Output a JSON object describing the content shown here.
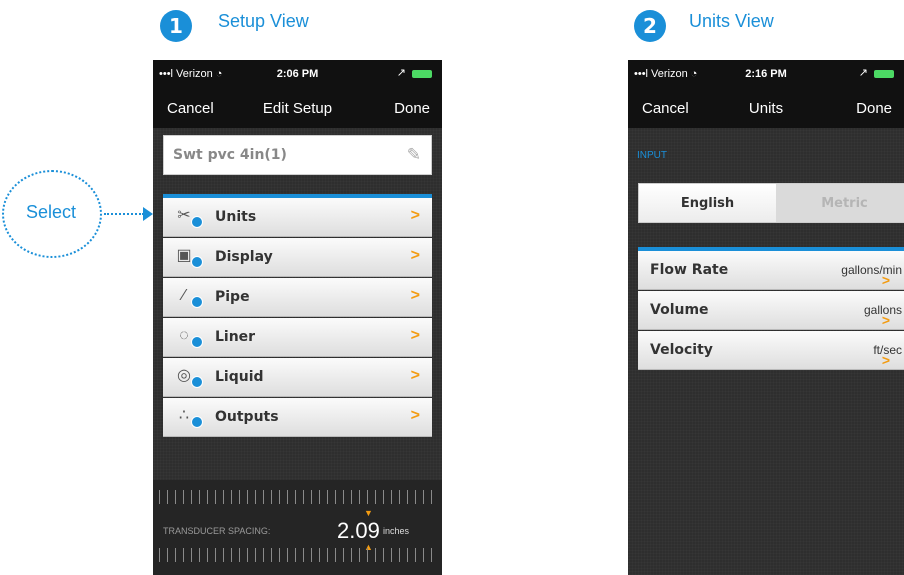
{
  "steps": [
    {
      "number": "1",
      "title": "Setup View"
    },
    {
      "number": "2",
      "title": "Units View"
    }
  ],
  "callout": {
    "label": "Select"
  },
  "setup_view": {
    "status": {
      "carrier": "•••l Verizon ◔",
      "time": "2:06 PM",
      "location_glyph": "↗"
    },
    "nav": {
      "left": "Cancel",
      "title": "Edit Setup",
      "right": "Done"
    },
    "name_field": {
      "value": "Swt pvc 4in(1)",
      "icon": "pencil-icon"
    },
    "menu_items": [
      {
        "label": "Units",
        "icon": "ruler-icon",
        "glyph": "✂",
        "chevron": ">"
      },
      {
        "label": "Display",
        "icon": "display-icon",
        "glyph": "▣",
        "chevron": ">"
      },
      {
        "label": "Pipe",
        "icon": "pipe-icon",
        "glyph": "∕",
        "chevron": ">"
      },
      {
        "label": "Liner",
        "icon": "liner-icon",
        "glyph": "◌",
        "chevron": ">"
      },
      {
        "label": "Liquid",
        "icon": "liquid-icon",
        "glyph": "◎",
        "chevron": ">"
      },
      {
        "label": "Outputs",
        "icon": "outputs-icon",
        "glyph": "∴",
        "chevron": ">"
      }
    ],
    "transducer": {
      "label": "TRANSDUCER SPACING:",
      "value": "2.09",
      "unit": "inches"
    }
  },
  "units_view": {
    "status": {
      "carrier": "•••l Verizon ◔",
      "time": "2:16 PM",
      "location_glyph": "↗"
    },
    "nav": {
      "left": "Cancel",
      "title": "Units",
      "right": "Done"
    },
    "section_label": "INPUT",
    "segmented": {
      "options": [
        "English",
        "Metric"
      ],
      "selected": "English"
    },
    "rows": [
      {
        "label": "Flow Rate",
        "value": "gallons/min",
        "chevron": ">"
      },
      {
        "label": "Volume",
        "value": "gallons",
        "chevron": ">"
      },
      {
        "label": "Velocity",
        "value": "ft/sec",
        "chevron": ">"
      }
    ]
  },
  "colors": {
    "accent": "#1a8fd8",
    "chevron": "#f39c12",
    "navbar": "#111111",
    "background": "#2e2e2e"
  }
}
